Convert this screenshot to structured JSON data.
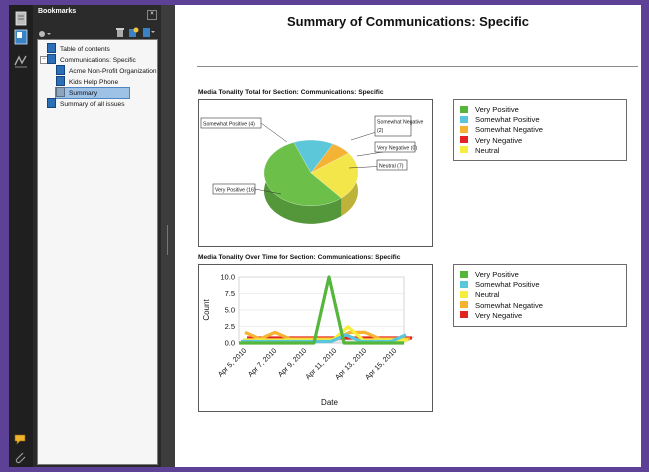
{
  "bookmarks_panel": {
    "title": "Bookmarks",
    "items": [
      {
        "label": "Table of contents"
      },
      {
        "label": "Communications: Specific"
      },
      {
        "label": "Acme Non-Profit Organization"
      },
      {
        "label": "Kids Help Phone"
      },
      {
        "label": "Summary"
      },
      {
        "label": "Summary of all issues"
      }
    ]
  },
  "document": {
    "title": "Summary of Communications: Specific"
  },
  "chart_data": [
    {
      "type": "pie",
      "title": "Media Tonality Total for Section: Communications: Specific",
      "slices": [
        {
          "label": "Somewhat Positive (4)",
          "name": "Somewhat Positive",
          "value": 4,
          "color": "#5bc7d9"
        },
        {
          "label": "Somewhat Negative (2)",
          "name": "Somewhat Negative",
          "value": 2,
          "color": "#f5b335"
        },
        {
          "label": "Very Negative (0)",
          "name": "Very Negative",
          "value": 0,
          "color": "#e02525"
        },
        {
          "label": "Neutral (7)",
          "name": "Neutral",
          "value": 7,
          "color": "#f2e64a"
        },
        {
          "label": "Very Positive (16)",
          "name": "Very Positive",
          "value": 16,
          "color": "#6cc04a"
        }
      ],
      "legend": [
        {
          "label": "Very Positive",
          "color": "#55b63c"
        },
        {
          "label": "Somewhat Positive",
          "color": "#59c6dc"
        },
        {
          "label": "Somewhat Negative",
          "color": "#f6b230"
        },
        {
          "label": "Very Negative",
          "color": "#e52222"
        },
        {
          "label": "Neutral",
          "color": "#f6ee3c"
        }
      ]
    },
    {
      "type": "line",
      "title": "Media Tonality Over Time for Section: Communications: Specific",
      "xlabel": "Date",
      "ylabel": "Count",
      "ylim": [
        0,
        10
      ],
      "yticks": [
        "10.0",
        "7.5",
        "5.0",
        "2.5",
        "0.0"
      ],
      "xticks": [
        "Apr 5, 2010",
        "Apr 7, 2010",
        "Apr 9, 2010",
        "Apr 11, 2010",
        "Apr 13, 2010",
        "Apr 15, 2010"
      ],
      "x": [
        "Apr 5, 2010",
        "Apr 6, 2010",
        "Apr 7, 2010",
        "Apr 8, 2010",
        "Apr 9, 2010",
        "Apr 10, 2010",
        "Apr 11, 2010",
        "Apr 12, 2010",
        "Apr 13, 2010",
        "Apr 14, 2010",
        "Apr 15, 2010",
        "Apr 16, 2010"
      ],
      "series": [
        {
          "name": "Very Negative",
          "color": "#e52222",
          "values": [
            0,
            0,
            0,
            0,
            0,
            0,
            0,
            0,
            0,
            0,
            0,
            0
          ]
        },
        {
          "name": "Somewhat Negative",
          "color": "#f6b230",
          "values": [
            1,
            0,
            1,
            0,
            0,
            0,
            0,
            1,
            1,
            0,
            0,
            0
          ]
        },
        {
          "name": "Neutral",
          "color": "#f6ee3c",
          "values": [
            0,
            0,
            0,
            0,
            0,
            0,
            0,
            2,
            0,
            0,
            0,
            0
          ]
        },
        {
          "name": "Somewhat Positive",
          "color": "#59c6dc",
          "values": [
            0,
            0,
            0,
            0,
            0,
            0,
            0,
            1,
            0,
            0,
            0,
            1
          ]
        },
        {
          "name": "Very Positive",
          "color": "#55b63c",
          "values": [
            0,
            0,
            0,
            0,
            0,
            0,
            10,
            0,
            0,
            0,
            0,
            0
          ]
        }
      ],
      "legend": [
        {
          "label": "Very Positive",
          "color": "#55b63c"
        },
        {
          "label": "Somewhat Positive",
          "color": "#59c6dc"
        },
        {
          "label": "Neutral",
          "color": "#f6ee3c"
        },
        {
          "label": "Somewhat Negative",
          "color": "#f6b230"
        },
        {
          "label": "Very Negative",
          "color": "#e52222"
        }
      ]
    }
  ]
}
